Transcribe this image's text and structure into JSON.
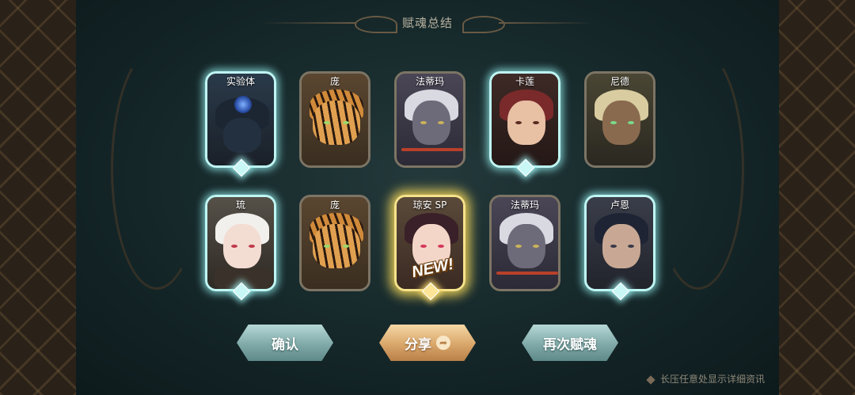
{
  "title": "赋魂总结",
  "cards_row1": [
    {
      "name": "实验体",
      "glow": "teal"
    },
    {
      "name": "庞",
      "glow": "none"
    },
    {
      "name": "法蒂玛",
      "glow": "none"
    },
    {
      "name": "卡莲",
      "glow": "teal"
    },
    {
      "name": "尼德",
      "glow": "none"
    }
  ],
  "cards_row2": [
    {
      "name": "琉",
      "glow": "teal"
    },
    {
      "name": "庞",
      "glow": "none"
    },
    {
      "name": "琼安 SP",
      "glow": "gold",
      "badge": "NEW!"
    },
    {
      "name": "法蒂玛",
      "glow": "none"
    },
    {
      "name": "卢恩",
      "glow": "teal"
    }
  ],
  "buttons": {
    "confirm": "确认",
    "share": "分享",
    "again": "再次赋魂"
  },
  "hint": "长压任意处显示详细资讯",
  "colors": {
    "teal_glow": "#bff6f4",
    "gold_glow": "#f6e28a",
    "button_teal": "#7fa9a8",
    "button_gold": "#d9a66a"
  }
}
